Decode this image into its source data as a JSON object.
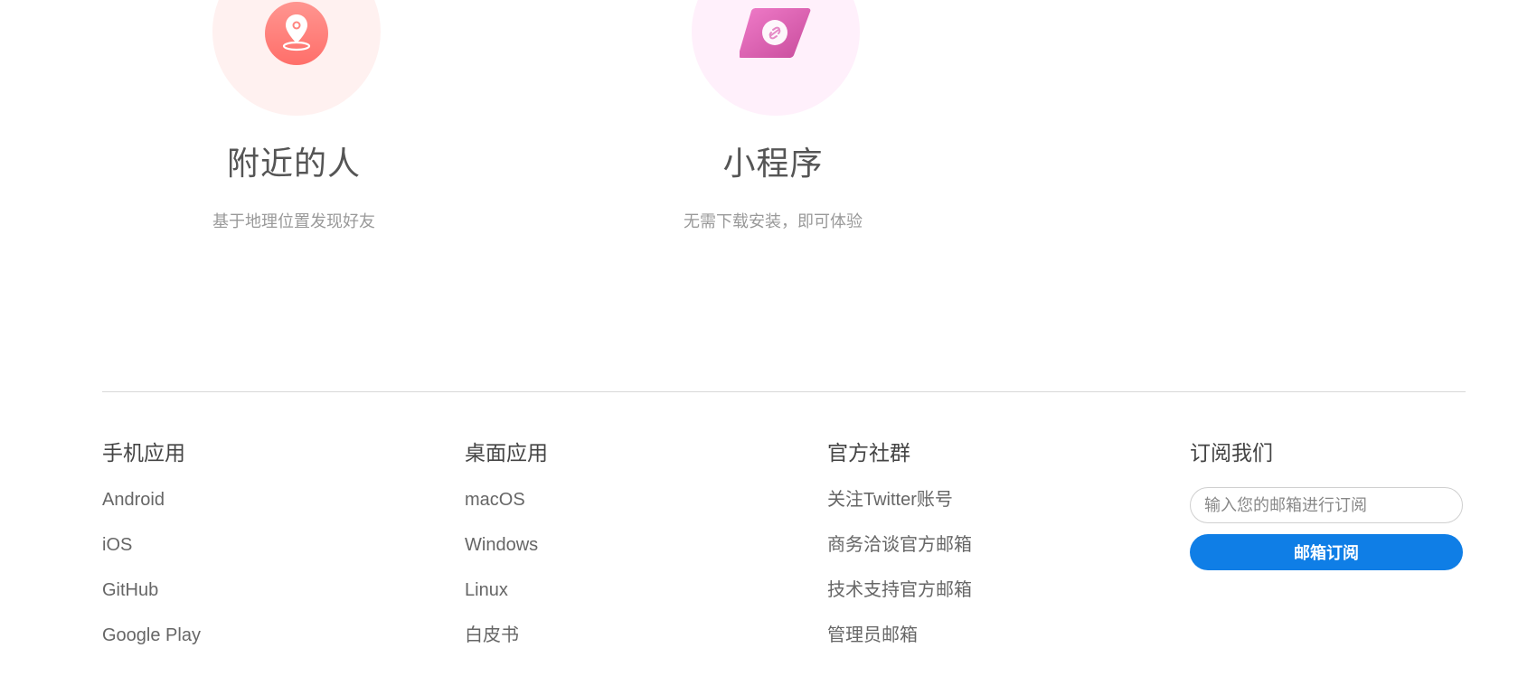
{
  "features": [
    {
      "title": "附近的人",
      "desc": "基于地理位置发现好友",
      "icon": "location-pin-icon",
      "color": "#ff7e7a"
    },
    {
      "title": "小程序",
      "desc": "无需下载安装，即可体验",
      "icon": "link-card-icon",
      "color": "#d85fb0"
    }
  ],
  "footer": {
    "mobile": {
      "heading": "手机应用",
      "links": [
        "Android",
        "iOS",
        "GitHub",
        "Google Play"
      ]
    },
    "desktop": {
      "heading": "桌面应用",
      "links": [
        "macOS",
        "Windows",
        "Linux",
        "白皮书"
      ]
    },
    "community": {
      "heading": "官方社群",
      "links": [
        "关注Twitter账号",
        "商务洽谈官方邮箱",
        "技术支持官方邮箱",
        "管理员邮箱"
      ]
    },
    "subscribe": {
      "heading": "订阅我们",
      "placeholder": "输入您的邮箱进行订阅",
      "button": "邮箱订阅",
      "button_color": "#0f7ee6"
    }
  }
}
